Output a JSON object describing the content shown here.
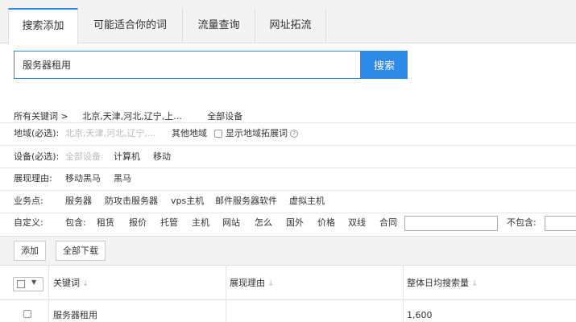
{
  "tabs": [
    {
      "label": "搜索添加",
      "active": true
    },
    {
      "label": "可能适合你的词",
      "active": false
    },
    {
      "label": "流量查询",
      "active": false
    },
    {
      "label": "网址拓流",
      "active": false
    }
  ],
  "search": {
    "value": "服务器租用",
    "button": "搜索"
  },
  "crumb": {
    "root": "所有关键词 >",
    "tags": [
      "北京,天津,河北,辽宁,上...",
      "全部设备"
    ]
  },
  "filters": {
    "region": {
      "label": "地域(必选):",
      "placeholder": "北京,天津,河北,辽宁,...",
      "other": "其他地域",
      "expand": "显示地域拓展词"
    },
    "device": {
      "label": "设备(必选):",
      "all": "全部设备",
      "options": [
        "计算机",
        "移动"
      ]
    },
    "reason": {
      "label": "展现理由:",
      "options": [
        "移动黑马",
        "黑马"
      ]
    },
    "business": {
      "label": "业务点:",
      "options": [
        "服务器",
        "防攻击服务器",
        "vps主机",
        "邮件服务器软件",
        "虚拟主机"
      ]
    },
    "custom": {
      "label": "自定义:",
      "include_label": "包含:",
      "options": [
        "租赁",
        "报价",
        "托管",
        "主机",
        "网站",
        "怎么",
        "国外",
        "价格",
        "双线",
        "合同"
      ],
      "exclude_label": "不包含:"
    }
  },
  "toolbar": {
    "add": "添加",
    "download_all": "全部下载"
  },
  "table": {
    "headers": [
      "关键词",
      "展现理由",
      "整体日均搜索量"
    ],
    "sort_icon": "↓",
    "dropdown_icon": "▼",
    "rows": [
      {
        "keyword": "服务器租用",
        "reason": "",
        "volume": "1,600"
      }
    ]
  }
}
